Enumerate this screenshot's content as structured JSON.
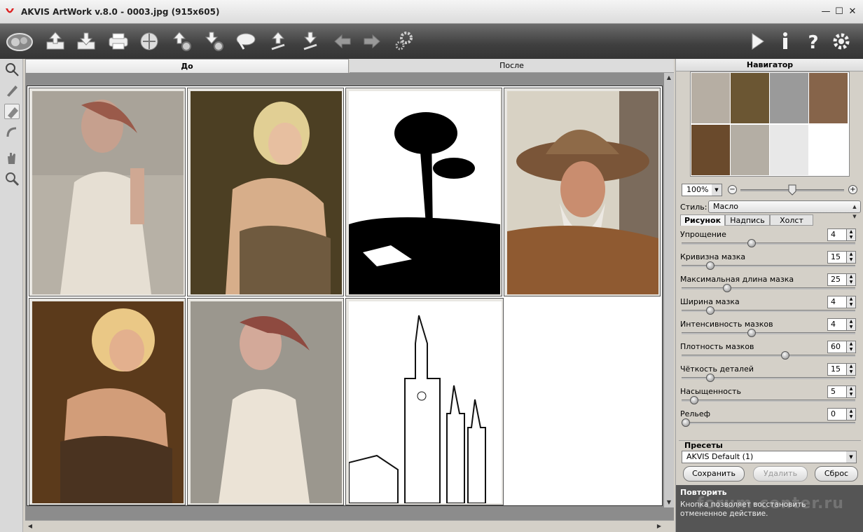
{
  "window": {
    "title": "AKVIS ArtWork v.8.0 - 0003.jpg (915x605)",
    "controls": [
      "minimize",
      "maximize",
      "close"
    ]
  },
  "toolbar": {
    "left_icons": [
      "akvis-logo-icon",
      "open-icon",
      "save-icon",
      "print-icon",
      "share-icon",
      "batch-open-icon",
      "batch-save-icon",
      "eraser-icon",
      "import-strokes-icon",
      "export-strokes-icon",
      "undo-icon",
      "redo-icon",
      "preferences-gears-icon"
    ],
    "right_icons": [
      "run-icon",
      "info-icon",
      "help-icon",
      "settings-icon"
    ]
  },
  "left_tools": [
    "direction-tool-icon",
    "brush-tool-icon",
    "eraser-tool-icon",
    "history-brush-icon",
    "hand-tool-icon",
    "zoom-tool-icon"
  ],
  "tabs": {
    "before": "До",
    "after": "После"
  },
  "navigator": {
    "title": "Навигатор",
    "zoom": "100%"
  },
  "style": {
    "label": "Стиль:",
    "value": "Масло"
  },
  "param_tabs": [
    "Рисунок",
    "Надпись",
    "Холст"
  ],
  "params": [
    {
      "label": "Упрощение",
      "value": "4",
      "level": 0.4
    },
    {
      "label": "Кривизна мазка",
      "value": "15",
      "level": 0.15
    },
    {
      "label": "Максимальная длина мазка",
      "value": "25",
      "level": 0.25
    },
    {
      "label": "Ширина мазка",
      "value": "4",
      "level": 0.15
    },
    {
      "label": "Интенсивность мазков",
      "value": "4",
      "level": 0.4
    },
    {
      "label": "Плотность мазков",
      "value": "60",
      "level": 0.6
    },
    {
      "label": "Чёткость деталей",
      "value": "15",
      "level": 0.15
    },
    {
      "label": "Насыщенность",
      "value": "5",
      "level": 0.05
    },
    {
      "label": "Рельеф",
      "value": "0",
      "level": 0.0
    }
  ],
  "presets": {
    "title": "Пресеты",
    "selected": "AKVIS Default (1)",
    "save": "Сохранить",
    "delete": "Удалить",
    "reset": "Сброс"
  },
  "help": {
    "title": "Повторить",
    "text": "Кнопка позволяет восстановить отмененное действие.",
    "watermark": "forum-center.ru"
  },
  "colors": {
    "toolbar_bg": "#444444",
    "panel_bg": "#d4d0c8",
    "help_bg": "#555555",
    "canvas_bg": "#8c8c8c"
  }
}
